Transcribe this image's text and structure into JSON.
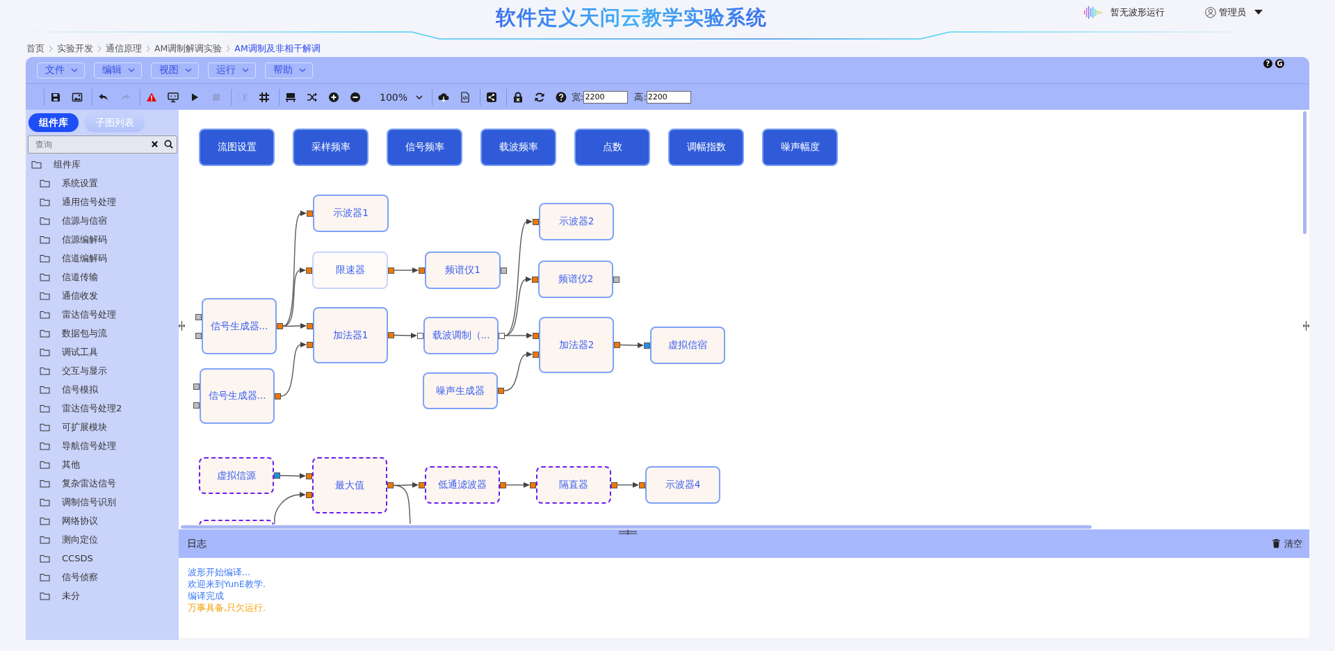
{
  "header": {
    "title": "软件定义天问云教学实验系统",
    "status": "暂无波形运行",
    "user": "管理员"
  },
  "breadcrumb": [
    {
      "label": "首页",
      "selected": false
    },
    {
      "label": "实验开发",
      "selected": false
    },
    {
      "label": "通信原理",
      "selected": false
    },
    {
      "label": "AM调制解调实验",
      "selected": false
    },
    {
      "label": "AM调制及非相干解调",
      "selected": true
    }
  ],
  "menu": [
    "文件",
    "编辑",
    "视图",
    "运行",
    "帮助"
  ],
  "corner_buttons": [
    "?",
    "G"
  ],
  "toolbar": [
    [
      {
        "kind": "save",
        "disabled": false
      },
      {
        "kind": "image",
        "disabled": false
      }
    ],
    [
      {
        "kind": "undo",
        "disabled": false
      },
      {
        "kind": "redo",
        "disabled": true
      }
    ],
    [
      {
        "kind": "warning",
        "disabled": false
      },
      {
        "kind": "monitor",
        "disabled": false
      },
      {
        "kind": "play",
        "disabled": false
      },
      {
        "kind": "stop",
        "disabled": true
      }
    ],
    [
      {
        "kind": "frame",
        "disabled": true
      },
      {
        "kind": "grid",
        "disabled": false
      }
    ],
    [
      {
        "kind": "dock",
        "disabled": false
      },
      {
        "kind": "shuffle",
        "disabled": false
      },
      {
        "kind": "zoom-in",
        "disabled": false
      },
      {
        "kind": "zoom-out",
        "disabled": false
      },
      {
        "kind": "zoom",
        "value": "100%"
      }
    ],
    [
      {
        "kind": "cloud",
        "disabled": false
      },
      {
        "kind": "code",
        "disabled": false
      }
    ],
    [
      {
        "kind": "share",
        "disabled": false
      }
    ],
    [
      {
        "kind": "lock",
        "disabled": false
      },
      {
        "kind": "refresh",
        "disabled": false
      },
      {
        "kind": "help",
        "disabled": false
      },
      {
        "kind": "field",
        "label": "宽:",
        "value": "2200"
      },
      {
        "kind": "field",
        "label": "高:",
        "value": "2200"
      }
    ]
  ],
  "sidebar": {
    "tabs": [
      {
        "label": "组件库",
        "selected": true
      },
      {
        "label": "子图列表",
        "selected": false
      }
    ],
    "search": {
      "placeholder": "查询"
    },
    "tree": [
      {
        "label": "组件库",
        "children": [
          {
            "label": "系统设置"
          },
          {
            "label": "通用信号处理"
          },
          {
            "label": "信源与信宿"
          },
          {
            "label": "信源编解码"
          },
          {
            "label": "信道编解码"
          },
          {
            "label": "信道传输"
          },
          {
            "label": "通信收发"
          },
          {
            "label": "雷达信号处理"
          },
          {
            "label": "数据包与流"
          },
          {
            "label": "调试工具"
          },
          {
            "label": "交互与显示"
          },
          {
            "label": "信号模拟"
          },
          {
            "label": "雷达信号处理2"
          },
          {
            "label": "可扩展模块"
          },
          {
            "label": "导航信号处理"
          },
          {
            "label": "其他"
          },
          {
            "label": "复杂雷达信号"
          },
          {
            "label": "调制信号识别"
          },
          {
            "label": "网络协议"
          },
          {
            "label": "测向定位"
          },
          {
            "label": "CCSDS"
          },
          {
            "label": "信号侦察"
          },
          {
            "label": "未分"
          }
        ]
      }
    ]
  },
  "canvas": {
    "parameters": [
      "流图设置",
      "采样频率",
      "信号频率",
      "载波频率",
      "点数",
      "调幅指数",
      "噪声幅度"
    ],
    "nodes": [
      {
        "label": "示波器1",
        "kind": "normal",
        "inputs": [
          {
            "color": "#f07800"
          }
        ]
      },
      {
        "label": "限速器",
        "kind": "faded",
        "inputs": [
          {
            "color": "#f07800"
          }
        ],
        "outputs": [
          {
            "color": "#f07800"
          }
        ]
      },
      {
        "label": "频谱仪1",
        "kind": "normal",
        "inputs": [
          {
            "color": "#f07800"
          }
        ],
        "outputs": [
          {
            "color": "#bdbdbd"
          }
        ]
      },
      {
        "label": "信号生成器...",
        "kind": "normal",
        "inputs": [
          {
            "color": "#bdbdbd"
          },
          {
            "color": "#bdbdbd"
          }
        ],
        "outputs": [
          {
            "color": "#f07800"
          }
        ]
      },
      {
        "label": "加法器1",
        "kind": "normal",
        "inputs": [
          {
            "color": "#f07800"
          },
          {
            "color": "#f07800"
          }
        ],
        "outputs": [
          {
            "color": "#f07800"
          }
        ]
      },
      {
        "label": "载波调制（...",
        "kind": "normal",
        "inputs": [
          {
            "color": "#ffffff"
          }
        ],
        "outputs": [
          {
            "color": "#ffffff"
          }
        ]
      },
      {
        "label": "示波器2",
        "kind": "normal",
        "inputs": [
          {
            "color": "#f07800"
          }
        ]
      },
      {
        "label": "频谱仪2",
        "kind": "normal",
        "inputs": [
          {
            "color": "#f07800"
          }
        ],
        "outputs": [
          {
            "color": "#bdbdbd"
          }
        ]
      },
      {
        "label": "加法器2",
        "kind": "normal",
        "inputs": [
          {
            "color": "#f07800"
          },
          {
            "color": "#f07800"
          }
        ],
        "outputs": [
          {
            "color": "#f07800"
          }
        ]
      },
      {
        "label": "虚拟信宿",
        "kind": "normal",
        "inputs": [
          {
            "color": "#1e90e8"
          }
        ]
      },
      {
        "label": "信号生成器...",
        "kind": "normal",
        "inputs": [
          {
            "color": "#bdbdbd"
          },
          {
            "color": "#bdbdbd"
          }
        ],
        "outputs": [
          {
            "color": "#f07800"
          }
        ]
      },
      {
        "label": "噪声生成器",
        "kind": "normal",
        "outputs": [
          {
            "color": "#f07800"
          }
        ]
      },
      {
        "label": "虚拟信源",
        "kind": "dashed",
        "outputs": [
          {
            "color": "#1e90e8"
          }
        ]
      },
      {
        "label": "最大值",
        "kind": "dashed",
        "inputs": [
          {
            "color": "#f07800"
          },
          {
            "color": "#f07800"
          }
        ],
        "outputs": [
          {
            "color": "#f07800"
          }
        ]
      },
      {
        "label": "低通滤波器",
        "kind": "dashed",
        "inputs": [
          {
            "color": "#f07800"
          }
        ],
        "outputs": [
          {
            "color": "#f07800"
          }
        ]
      },
      {
        "label": "隔直器",
        "kind": "dashed",
        "inputs": [
          {
            "color": "#f07800"
          }
        ],
        "outputs": [
          {
            "color": "#f07800"
          }
        ]
      },
      {
        "label": "示波器4",
        "kind": "normal",
        "inputs": [
          {
            "color": "#f07800"
          }
        ]
      },
      {
        "kind": "dashed"
      }
    ]
  },
  "log": {
    "title": "日志",
    "clear": "清空",
    "lines": [
      {
        "text": "波形开始编译...",
        "kind": "info"
      },
      {
        "text": "欢迎来到YunE教学.",
        "kind": "info"
      },
      {
        "text": "编译完成",
        "kind": "info"
      },
      {
        "text": "万事具备,只欠运行.",
        "kind": "warning"
      }
    ]
  }
}
